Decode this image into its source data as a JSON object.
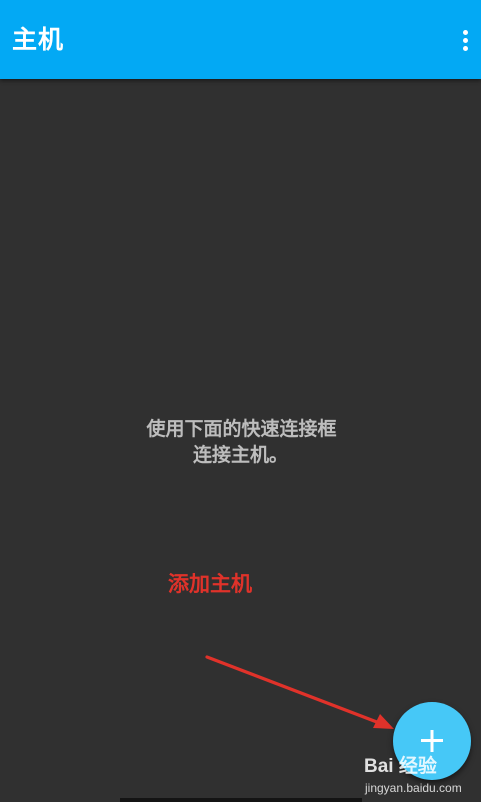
{
  "appbar": {
    "title": "主机",
    "overflow_icon": "more-vert-icon",
    "color": "#03a9f4"
  },
  "main": {
    "empty_message": [
      "使用下面的快速连接框",
      "连接主机。"
    ],
    "background": "#303030"
  },
  "annotation": {
    "label": "添加主机",
    "color": "#e0322a"
  },
  "fab": {
    "icon": "plus-icon",
    "color": "#46c8f7"
  },
  "watermark": {
    "brand": "Bai 经验",
    "url": "jingyan.baidu.com"
  }
}
